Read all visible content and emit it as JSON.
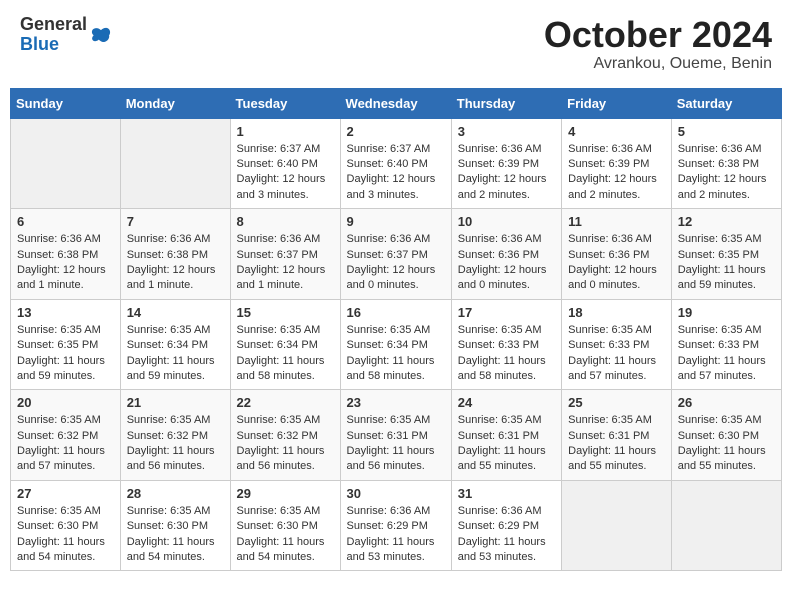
{
  "header": {
    "logo": {
      "general": "General",
      "blue": "Blue"
    },
    "title": "October 2024",
    "location": "Avrankou, Oueme, Benin"
  },
  "calendar": {
    "weekdays": [
      "Sunday",
      "Monday",
      "Tuesday",
      "Wednesday",
      "Thursday",
      "Friday",
      "Saturday"
    ],
    "weeks": [
      [
        {
          "day": "",
          "info": ""
        },
        {
          "day": "",
          "info": ""
        },
        {
          "day": "1",
          "info": "Sunrise: 6:37 AM\nSunset: 6:40 PM\nDaylight: 12 hours\nand 3 minutes."
        },
        {
          "day": "2",
          "info": "Sunrise: 6:37 AM\nSunset: 6:40 PM\nDaylight: 12 hours\nand 3 minutes."
        },
        {
          "day": "3",
          "info": "Sunrise: 6:36 AM\nSunset: 6:39 PM\nDaylight: 12 hours\nand 2 minutes."
        },
        {
          "day": "4",
          "info": "Sunrise: 6:36 AM\nSunset: 6:39 PM\nDaylight: 12 hours\nand 2 minutes."
        },
        {
          "day": "5",
          "info": "Sunrise: 6:36 AM\nSunset: 6:38 PM\nDaylight: 12 hours\nand 2 minutes."
        }
      ],
      [
        {
          "day": "6",
          "info": "Sunrise: 6:36 AM\nSunset: 6:38 PM\nDaylight: 12 hours\nand 1 minute."
        },
        {
          "day": "7",
          "info": "Sunrise: 6:36 AM\nSunset: 6:38 PM\nDaylight: 12 hours\nand 1 minute."
        },
        {
          "day": "8",
          "info": "Sunrise: 6:36 AM\nSunset: 6:37 PM\nDaylight: 12 hours\nand 1 minute."
        },
        {
          "day": "9",
          "info": "Sunrise: 6:36 AM\nSunset: 6:37 PM\nDaylight: 12 hours\nand 0 minutes."
        },
        {
          "day": "10",
          "info": "Sunrise: 6:36 AM\nSunset: 6:36 PM\nDaylight: 12 hours\nand 0 minutes."
        },
        {
          "day": "11",
          "info": "Sunrise: 6:36 AM\nSunset: 6:36 PM\nDaylight: 12 hours\nand 0 minutes."
        },
        {
          "day": "12",
          "info": "Sunrise: 6:35 AM\nSunset: 6:35 PM\nDaylight: 11 hours\nand 59 minutes."
        }
      ],
      [
        {
          "day": "13",
          "info": "Sunrise: 6:35 AM\nSunset: 6:35 PM\nDaylight: 11 hours\nand 59 minutes."
        },
        {
          "day": "14",
          "info": "Sunrise: 6:35 AM\nSunset: 6:34 PM\nDaylight: 11 hours\nand 59 minutes."
        },
        {
          "day": "15",
          "info": "Sunrise: 6:35 AM\nSunset: 6:34 PM\nDaylight: 11 hours\nand 58 minutes."
        },
        {
          "day": "16",
          "info": "Sunrise: 6:35 AM\nSunset: 6:34 PM\nDaylight: 11 hours\nand 58 minutes."
        },
        {
          "day": "17",
          "info": "Sunrise: 6:35 AM\nSunset: 6:33 PM\nDaylight: 11 hours\nand 58 minutes."
        },
        {
          "day": "18",
          "info": "Sunrise: 6:35 AM\nSunset: 6:33 PM\nDaylight: 11 hours\nand 57 minutes."
        },
        {
          "day": "19",
          "info": "Sunrise: 6:35 AM\nSunset: 6:33 PM\nDaylight: 11 hours\nand 57 minutes."
        }
      ],
      [
        {
          "day": "20",
          "info": "Sunrise: 6:35 AM\nSunset: 6:32 PM\nDaylight: 11 hours\nand 57 minutes."
        },
        {
          "day": "21",
          "info": "Sunrise: 6:35 AM\nSunset: 6:32 PM\nDaylight: 11 hours\nand 56 minutes."
        },
        {
          "day": "22",
          "info": "Sunrise: 6:35 AM\nSunset: 6:32 PM\nDaylight: 11 hours\nand 56 minutes."
        },
        {
          "day": "23",
          "info": "Sunrise: 6:35 AM\nSunset: 6:31 PM\nDaylight: 11 hours\nand 56 minutes."
        },
        {
          "day": "24",
          "info": "Sunrise: 6:35 AM\nSunset: 6:31 PM\nDaylight: 11 hours\nand 55 minutes."
        },
        {
          "day": "25",
          "info": "Sunrise: 6:35 AM\nSunset: 6:31 PM\nDaylight: 11 hours\nand 55 minutes."
        },
        {
          "day": "26",
          "info": "Sunrise: 6:35 AM\nSunset: 6:30 PM\nDaylight: 11 hours\nand 55 minutes."
        }
      ],
      [
        {
          "day": "27",
          "info": "Sunrise: 6:35 AM\nSunset: 6:30 PM\nDaylight: 11 hours\nand 54 minutes."
        },
        {
          "day": "28",
          "info": "Sunrise: 6:35 AM\nSunset: 6:30 PM\nDaylight: 11 hours\nand 54 minutes."
        },
        {
          "day": "29",
          "info": "Sunrise: 6:35 AM\nSunset: 6:30 PM\nDaylight: 11 hours\nand 54 minutes."
        },
        {
          "day": "30",
          "info": "Sunrise: 6:36 AM\nSunset: 6:29 PM\nDaylight: 11 hours\nand 53 minutes."
        },
        {
          "day": "31",
          "info": "Sunrise: 6:36 AM\nSunset: 6:29 PM\nDaylight: 11 hours\nand 53 minutes."
        },
        {
          "day": "",
          "info": ""
        },
        {
          "day": "",
          "info": ""
        }
      ]
    ]
  }
}
